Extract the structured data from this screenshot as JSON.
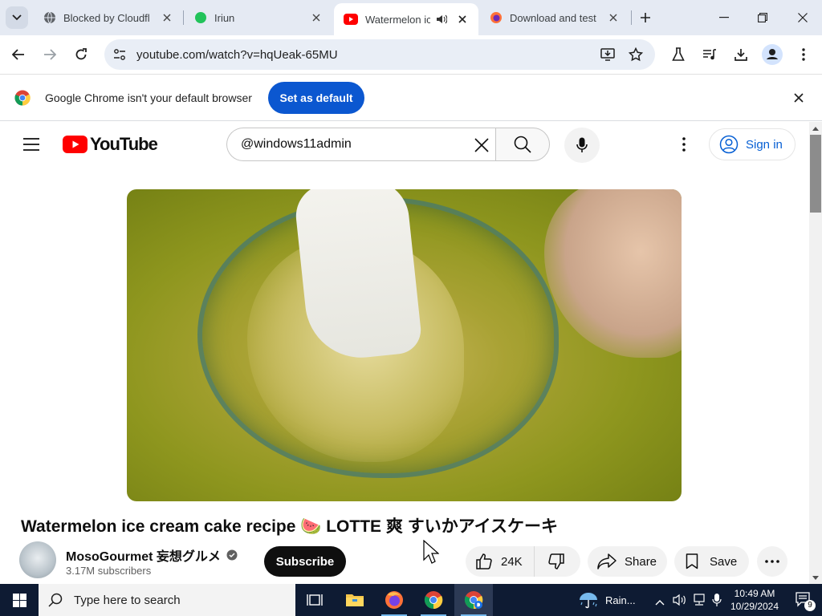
{
  "browser": {
    "tabs": [
      {
        "title": "Blocked by Cloudfl",
        "icon": "globe-icon"
      },
      {
        "title": "Iriun",
        "icon": "green-dot-icon"
      },
      {
        "title": "Watermelon ic",
        "icon": "youtube-icon",
        "active": true,
        "audio": true
      },
      {
        "title": "Download and test",
        "icon": "firefox-icon"
      }
    ],
    "url": "youtube.com/watch?v=hqUeak-65MU",
    "infobar": {
      "message": "Google Chrome isn't your default browser",
      "button": "Set as default"
    }
  },
  "youtube": {
    "logo_text": "YouTube",
    "search_value": "@windows11admin",
    "sign_in": "Sign in",
    "video": {
      "title": "Watermelon ice cream cake recipe 🍉 LOTTE 爽 すいかアイスケーキ",
      "channel": "MosoGourmet 妄想グルメ",
      "subscribers": "3.17M subscribers",
      "subscribe": "Subscribe",
      "likes": "24K",
      "share": "Share",
      "save": "Save"
    }
  },
  "taskbar": {
    "search_placeholder": "Type here to search",
    "weather": "Rain...",
    "time": "10:49 AM",
    "date": "10/29/2024",
    "notification_count": "9"
  },
  "colors": {
    "youtube_red": "#ff0000",
    "chrome_blue": "#0b57d0",
    "link_blue": "#065fd4",
    "taskbar": "#0e1b33"
  }
}
